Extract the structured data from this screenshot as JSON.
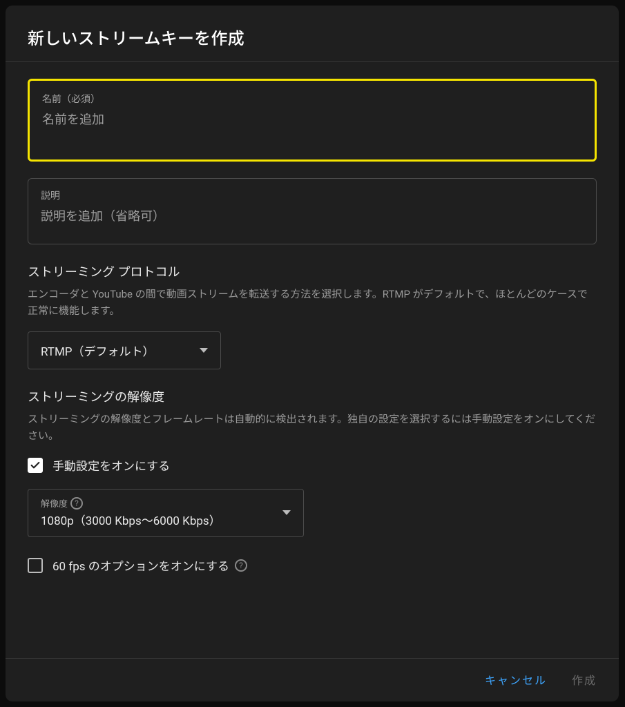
{
  "dialog": {
    "title": "新しいストリームキーを作成",
    "name_field": {
      "label": "名前（必須）",
      "placeholder": "名前を追加"
    },
    "description_field": {
      "label": "説明",
      "placeholder": "説明を追加（省略可）"
    },
    "protocol_section": {
      "title": "ストリーミング プロトコル",
      "description": "エンコーダと YouTube の間で動画ストリームを転送する方法を選択します。RTMP がデフォルトで、ほとんどのケースで正常に機能します。",
      "selected": "RTMP（デフォルト）"
    },
    "resolution_section": {
      "title": "ストリーミングの解像度",
      "description": "ストリーミングの解像度とフレームレートは自動的に検出されます。独自の設定を選択するには手動設定をオンにしてください。",
      "manual_toggle_label": "手動設定をオンにする",
      "manual_toggle_checked": true,
      "resolution_label": "解像度",
      "resolution_selected": "1080p（3000 Kbps～6000 Kbps）",
      "fps_toggle_label": "60 fps のオプションをオンにする",
      "fps_toggle_checked": false
    },
    "footer": {
      "cancel": "キャンセル",
      "create": "作成"
    }
  }
}
